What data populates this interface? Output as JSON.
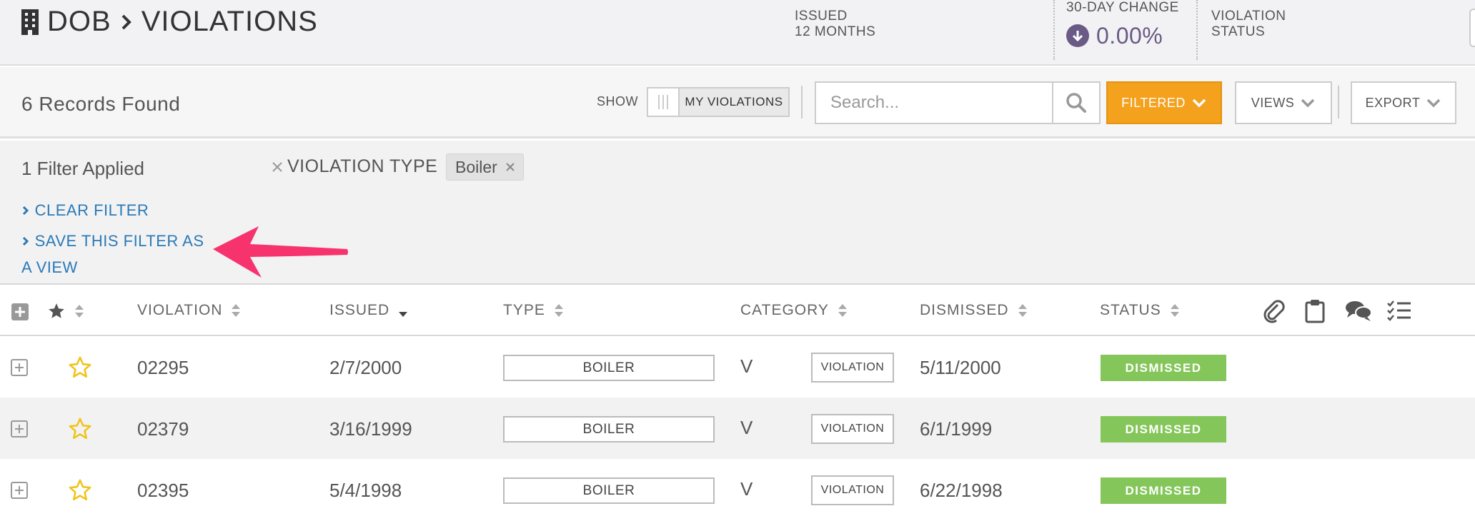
{
  "header": {
    "module": "DOB",
    "page": "VIOLATIONS",
    "issued_label_1": "ISSUED",
    "issued_label_2": "12 MONTHS",
    "change_label": "30-DAY CHANGE",
    "change_value": "0.00%",
    "status_label_1": "VIOLATION",
    "status_label_2": "STATUS"
  },
  "toolbar": {
    "records": "6 Records Found",
    "show_label": "SHOW",
    "toggle_label": "MY VIOLATIONS",
    "search_placeholder": "Search...",
    "filtered_label": "FILTERED",
    "views_label": "VIEWS",
    "export_label": "EXPORT"
  },
  "filter": {
    "applied": "1 Filter Applied",
    "field": "VIOLATION TYPE",
    "value": "Boiler",
    "clear_link": "CLEAR FILTER",
    "save_link": "SAVE THIS FILTER AS A VIEW"
  },
  "table": {
    "columns": {
      "violation": "VIOLATION",
      "issued": "ISSUED",
      "type": "TYPE",
      "category": "CATEGORY",
      "dismissed": "DISMISSED",
      "status": "STATUS"
    },
    "rows": [
      {
        "violation": "02295",
        "issued": "2/7/2000",
        "type": "BOILER",
        "cat_code": "V",
        "category": "VIOLATION",
        "dismissed": "5/11/2000",
        "status": "DISMISSED"
      },
      {
        "violation": "02379",
        "issued": "3/16/1999",
        "type": "BOILER",
        "cat_code": "V",
        "category": "VIOLATION",
        "dismissed": "6/1/1999",
        "status": "DISMISSED"
      },
      {
        "violation": "02395",
        "issued": "5/4/1998",
        "type": "BOILER",
        "cat_code": "V",
        "category": "VIOLATION",
        "dismissed": "6/22/1998",
        "status": "DISMISSED"
      }
    ]
  },
  "colors": {
    "accent_orange": "#f4a11d",
    "link_blue": "#2b7ab6",
    "status_green": "#84c65a",
    "change_purple": "#6a5a86",
    "star_yellow": "#f0c419",
    "annotation_pink": "#f7336e"
  },
  "icons": [
    "building-icon",
    "chevron-right-icon",
    "arrow-down-circle-icon",
    "search-icon",
    "chevron-down-icon",
    "close-icon",
    "expand-all-icon",
    "star-icon",
    "sort-icon",
    "paperclip-icon",
    "clipboard-icon",
    "comments-icon",
    "checklist-icon",
    "plus-square-icon",
    "star-outline-icon",
    "annotation-arrow"
  ]
}
